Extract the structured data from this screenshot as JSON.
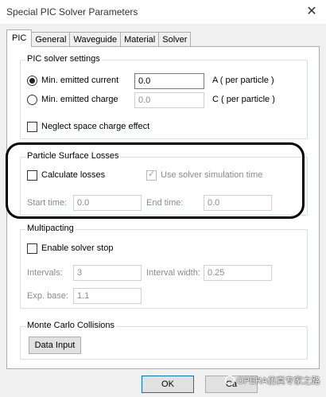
{
  "window": {
    "title": "Special PIC Solver Parameters",
    "close_glyph": "✕"
  },
  "tabs": [
    {
      "label": "PIC",
      "active": true
    },
    {
      "label": "General",
      "active": false
    },
    {
      "label": "Waveguide",
      "active": false
    },
    {
      "label": "Material",
      "active": false
    },
    {
      "label": "Solver",
      "active": false
    }
  ],
  "pic_settings": {
    "title": "PIC solver settings",
    "emitted_current": {
      "label": "Min. emitted current",
      "value": "0.0",
      "unit": "A  ( per particle )",
      "selected": true
    },
    "emitted_charge": {
      "label": "Min. emitted charge",
      "value": "0.0",
      "unit": "C  ( per particle )",
      "selected": false
    },
    "neglect_space_charge": {
      "label": "Neglect space charge effect",
      "checked": false
    }
  },
  "surface_losses": {
    "title": "Particle Surface Losses",
    "calculate_losses": {
      "label": "Calculate losses",
      "checked": false
    },
    "use_sim_time": {
      "label": "Use solver simulation time",
      "checked": true
    },
    "start_time": {
      "label": "Start time:",
      "value": "0.0"
    },
    "end_time": {
      "label": "End time:",
      "value": "0.0"
    }
  },
  "multipacting": {
    "title": "Multipacting",
    "enable_stop": {
      "label": "Enable solver stop",
      "checked": false
    },
    "intervals": {
      "label": "Intervals:",
      "value": "3"
    },
    "interval_width": {
      "label": "Interval width:",
      "value": "0.25"
    },
    "exp_base": {
      "label": "Exp. base:",
      "value": "1.1"
    }
  },
  "monte_carlo": {
    "title": "Monte Carlo Collisions",
    "data_input_label": "Data Input"
  },
  "footer": {
    "ok_label": "OK",
    "cancel_label": "Ca"
  },
  "watermark": {
    "text": "OPERA仿真专家之路"
  }
}
